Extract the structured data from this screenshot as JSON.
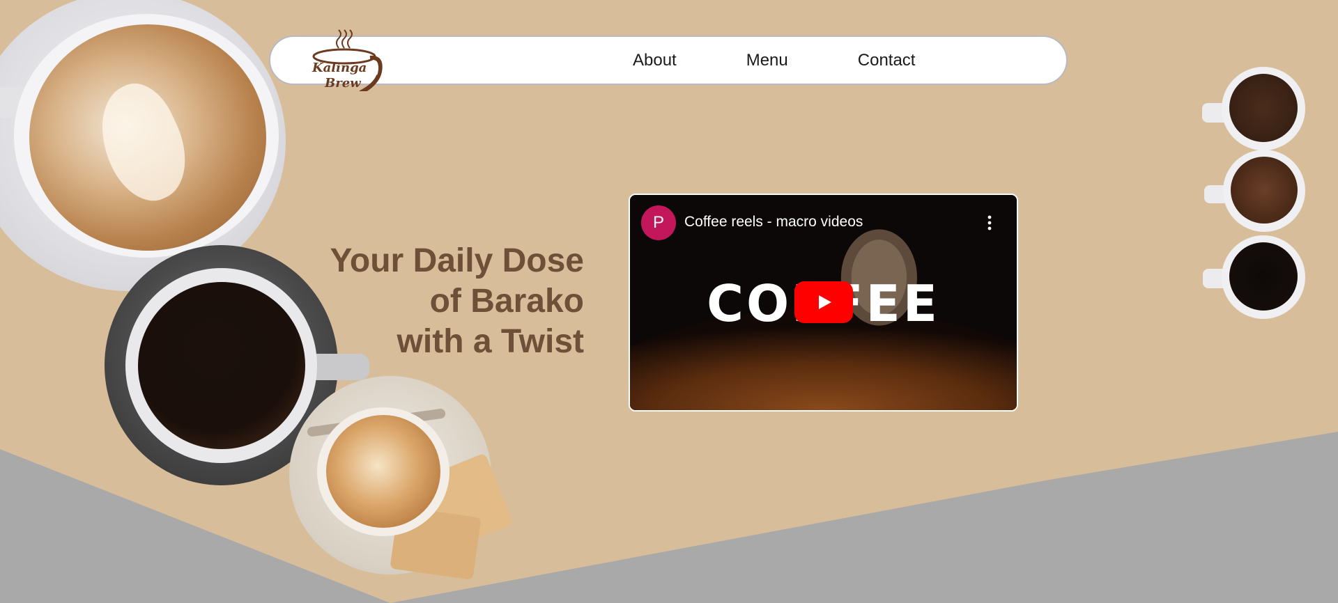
{
  "page": {
    "colors": {
      "background": "#d8bd9a",
      "floor": "#a9a9aa",
      "title": "#6e4f37",
      "logo": "#6b3a1f",
      "youtube_red": "#ff0000",
      "avatar": "#c2185b"
    }
  },
  "header": {
    "logo": {
      "line1": "Kalinga",
      "line2": "Brew",
      "icon": "coffee-cup-logo-icon"
    },
    "nav": [
      {
        "label": "About"
      },
      {
        "label": "Menu"
      },
      {
        "label": "Contact"
      }
    ]
  },
  "hero": {
    "title_lines": [
      "Your Daily Dose",
      "of Barako",
      "with a Twist"
    ]
  },
  "video": {
    "channel_initial": "P",
    "title": "Coffee reels - macro videos",
    "overlay_word": "COFFEE",
    "menu_icon": "more-vert-icon",
    "play_icon": "youtube-play-icon"
  },
  "decor": {
    "left_cups": [
      "latte-cup",
      "black-coffee-cup",
      "cappuccino-cup"
    ],
    "right_cups": [
      "coffee-beans-cup",
      "ground-coffee-cup",
      "espresso-cup"
    ]
  }
}
